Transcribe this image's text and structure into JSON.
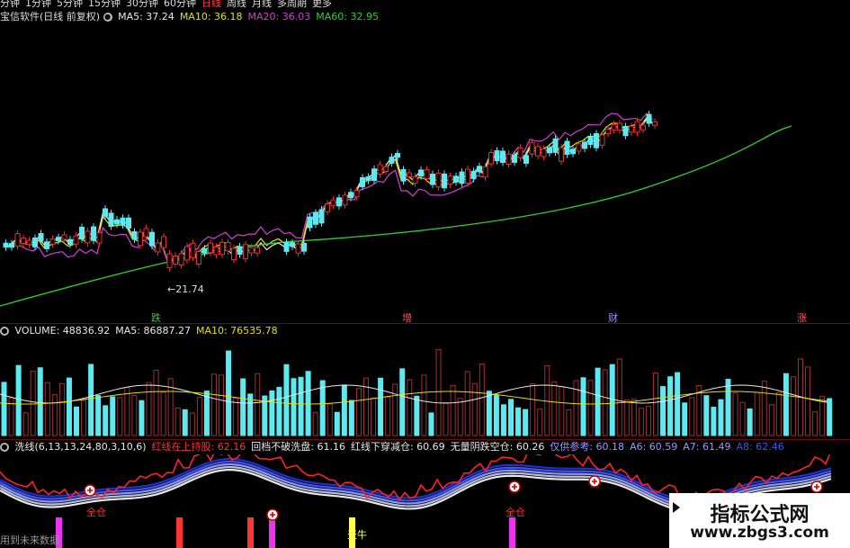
{
  "header": {
    "periods": [
      "分钟",
      "1分钟",
      "5分钟",
      "15分钟",
      "30分钟",
      "60分钟",
      "日线",
      "周线",
      "月线",
      "多周期",
      "更多"
    ],
    "active_period": "日线"
  },
  "main_panel": {
    "title": "宝信软件(日线 前复权)",
    "ma": [
      {
        "label": "MA5: 37.24",
        "color": "#e8e8e8"
      },
      {
        "label": "MA10: 36.18",
        "color": "#e8e000"
      },
      {
        "label": "MA20: 36.03",
        "color": "#d040d0"
      },
      {
        "label": "MA60: 32.95",
        "color": "#30d030"
      }
    ],
    "low_marker": "←21.74",
    "events": [
      {
        "label": "跌",
        "color": "#33cc33"
      },
      {
        "label": "增",
        "color": "#ff5555"
      },
      {
        "label": "财",
        "color": "#9999ff"
      },
      {
        "label": "涨",
        "color": "#ff5555"
      }
    ]
  },
  "volume_panel": {
    "items": [
      {
        "label": "VOLUME: 48836.92",
        "color": "#e8e8e8"
      },
      {
        "label": "MA5: 86887.27",
        "color": "#e8e8e8"
      },
      {
        "label": "MA10: 76535.78",
        "color": "#e8e000"
      }
    ]
  },
  "indicator_panel": {
    "items": [
      {
        "label": "洗线(6,13,13,24,80,3,10,6)",
        "color": "#e8e8e8"
      },
      {
        "label": "红线在上持股: 62.16",
        "color": "#ff3333"
      },
      {
        "label": "回档不破洗盘: 61.16",
        "color": "#e8e8e8"
      },
      {
        "label": "红线下穿减仓: 60.69",
        "color": "#e8e8e8"
      },
      {
        "label": "无量阴跌空仓: 60.26",
        "color": "#e8e8e8"
      },
      {
        "label": "仅供参考: 60.18",
        "color": "#9999ff"
      },
      {
        "label": "A6: 60.59",
        "color": "#9999ff"
      },
      {
        "label": "A7: 61.49",
        "color": "#9999ff"
      },
      {
        "label": "A8: 62.46",
        "color": "#3355ff"
      }
    ],
    "signals": [
      "全仓",
      "全仓",
      "天牛"
    ],
    "footer": "用到未来数据"
  },
  "watermark": {
    "line1": "指标公式网",
    "line2": "www.zbgs3.com"
  },
  "colors": {
    "up": "#e53030",
    "down": "#5ee8f0",
    "grid": "#6b0d0d"
  }
}
